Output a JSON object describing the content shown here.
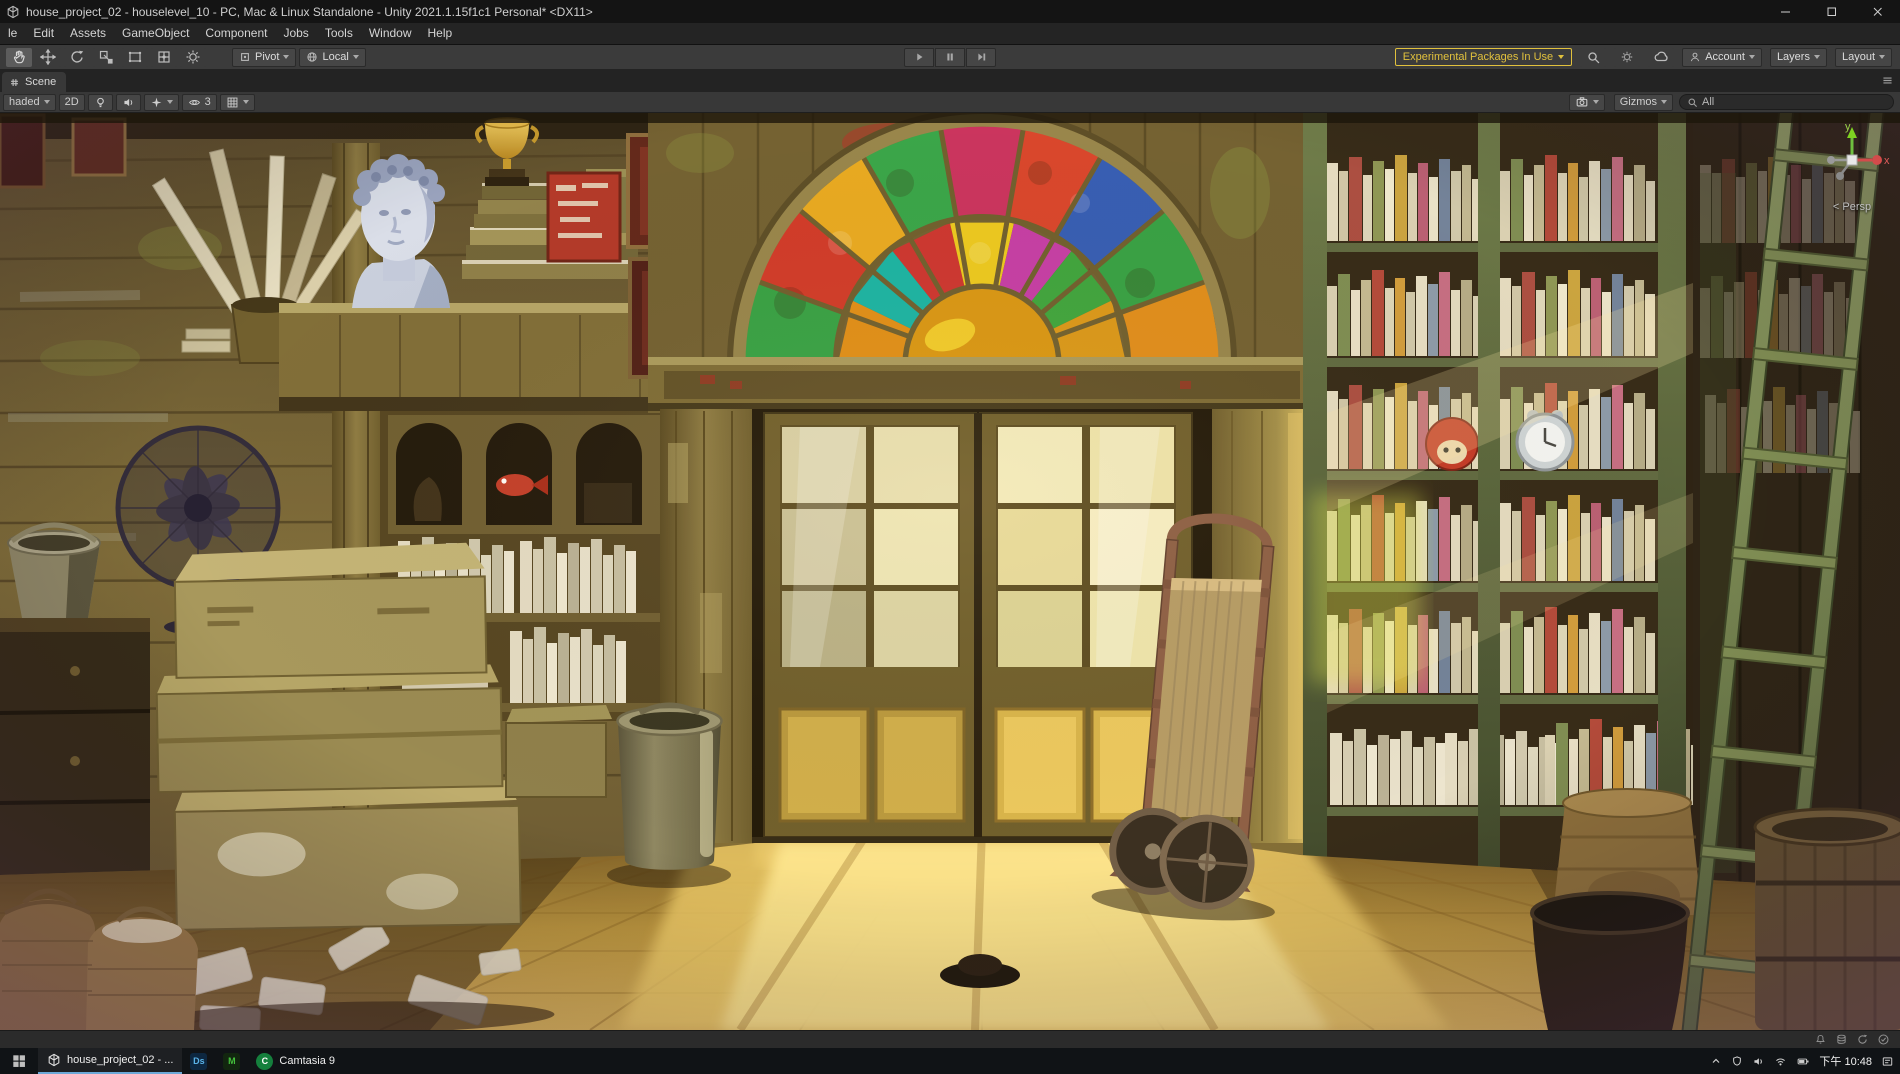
{
  "window": {
    "title": "house_project_02 - houselevel_10 - PC, Mac & Linux Standalone - Unity 2021.1.15f1c1 Personal* <DX11>"
  },
  "menu": {
    "items": [
      "le",
      "Edit",
      "Assets",
      "GameObject",
      "Component",
      "Jobs",
      "Tools",
      "Window",
      "Help"
    ]
  },
  "toolbar": {
    "pivot_label": "Pivot",
    "local_label": "Local",
    "experimental_label": "Experimental Packages In Use",
    "account_label": "Account",
    "layers_label": "Layers",
    "layout_label": "Layout"
  },
  "tabs": {
    "scene": "Scene"
  },
  "scene_toolbar": {
    "shading": "haded",
    "two_d": "2D",
    "hidden_count": "3",
    "gizmos": "Gizmos",
    "search_value": "All"
  },
  "viewport": {
    "axis_y": "y",
    "axis_x": "x",
    "projection_prefix": "<",
    "projection": "Persp"
  },
  "taskbar": {
    "unity_task": "house_project_02 - ...",
    "ds_label": "Ds",
    "m_label": "M",
    "camtasia_label": "Camtasia 9",
    "time": "下午 10:48"
  },
  "colors": {
    "experimental_yellow": "#e1c13d",
    "panel_dark": "#383838",
    "taskbar_dark": "#101316",
    "axis_y_green": "#8bc34a",
    "axis_x_red": "#d34b4b"
  }
}
